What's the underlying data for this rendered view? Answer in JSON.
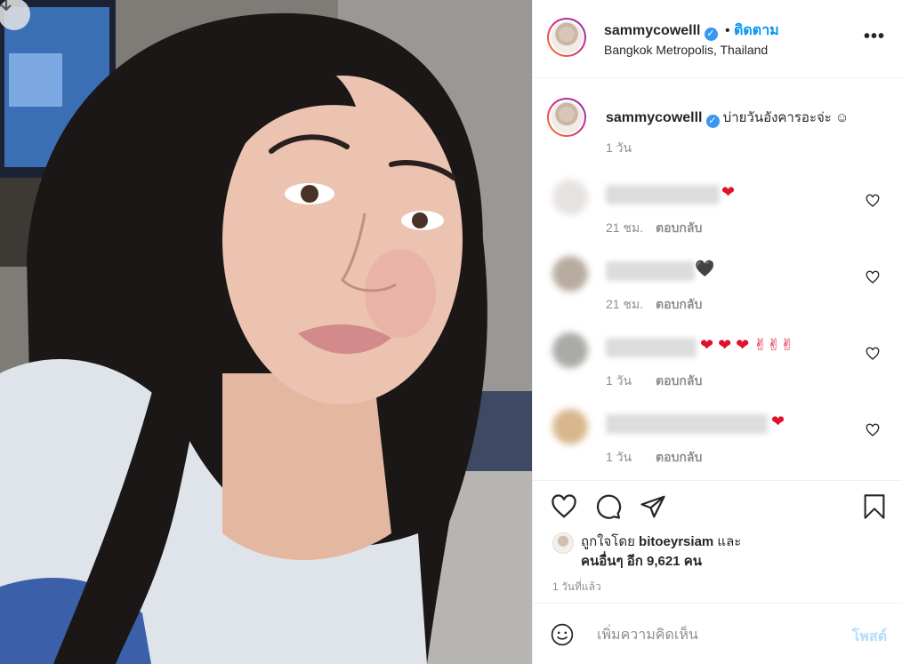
{
  "header": {
    "username": "sammycowelll",
    "separator": "•",
    "follow_label": "ติดตาม",
    "location": "Bangkok Metropolis, Thailand",
    "more_label": "•••"
  },
  "caption": {
    "username": "sammycowelll",
    "text": "บ่ายวันอังคารอะจ่ะ ☺",
    "time": "1 วัน"
  },
  "comments": [
    {
      "emoji": "❤",
      "time": "21 ชม.",
      "reply_label": "ตอบกลับ"
    },
    {
      "emoji": "🖤",
      "time": "21 ชม.",
      "reply_label": "ตอบกลับ"
    },
    {
      "emoji": "❤ ❤ ❤ ✌✌✌",
      "time": "1 วัน",
      "reply_label": "ตอบกลับ"
    },
    {
      "emoji": "❤",
      "time": "1 วัน",
      "reply_label": "ตอบกลับ"
    }
  ],
  "likes": {
    "prefix": "ถูกใจโดย",
    "user": "bitoeyrsiam",
    "joiner": "และ",
    "others": "คนอื่นๆ อีก 9,621 คน"
  },
  "posted_time": "1 วันที่แล้ว",
  "add_comment": {
    "placeholder": "เพิ่มความคิดเห็น",
    "post_label": "โพสต์"
  },
  "colors": {
    "link_blue": "#0095f6",
    "verified_blue": "#3897f0",
    "muted_text": "#8e8e8e",
    "post_disabled": "#b2dffc",
    "heart_red": "#e0112b"
  },
  "icons": [
    "download-icon",
    "verified-icon",
    "more-icon",
    "heart-icon",
    "comment-icon",
    "share-icon",
    "bookmark-icon",
    "smiley-icon"
  ]
}
